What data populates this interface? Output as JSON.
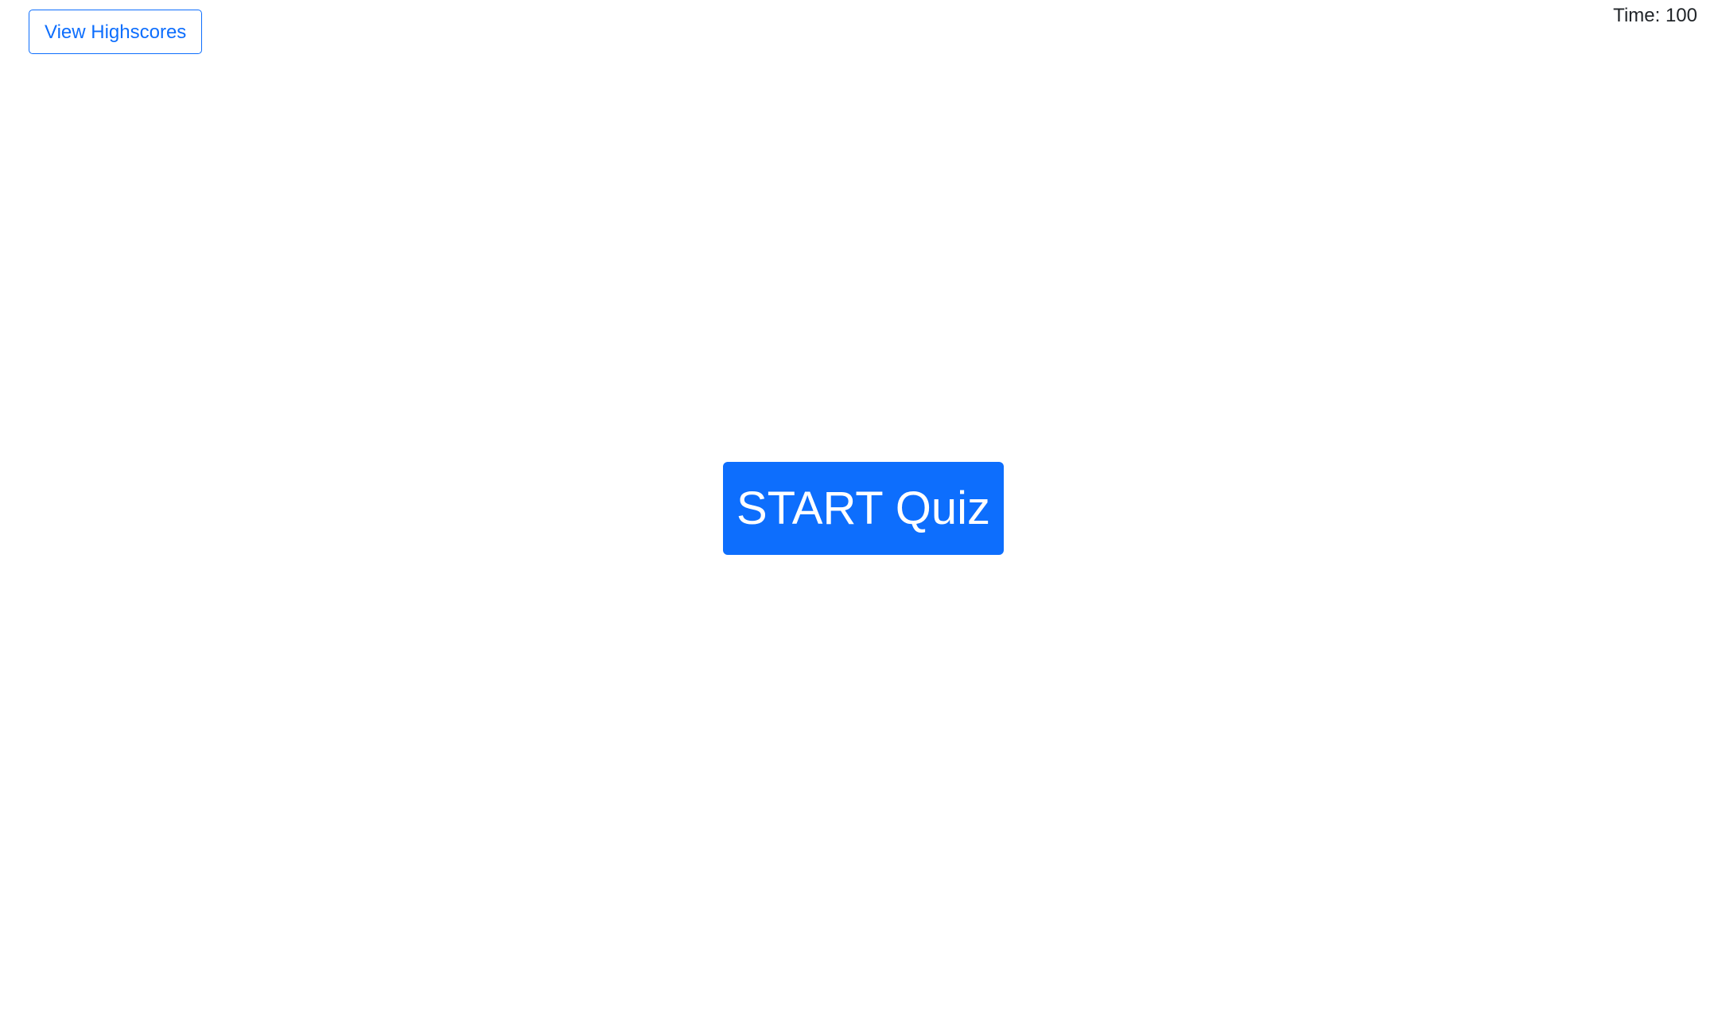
{
  "header": {
    "highscores_label": "View Highscores",
    "timer_label": "Time:",
    "timer_value": "100"
  },
  "main": {
    "start_label": "START Quiz"
  },
  "colors": {
    "accent": "#0d6efd",
    "background": "#ffffff",
    "text": "#212529"
  }
}
